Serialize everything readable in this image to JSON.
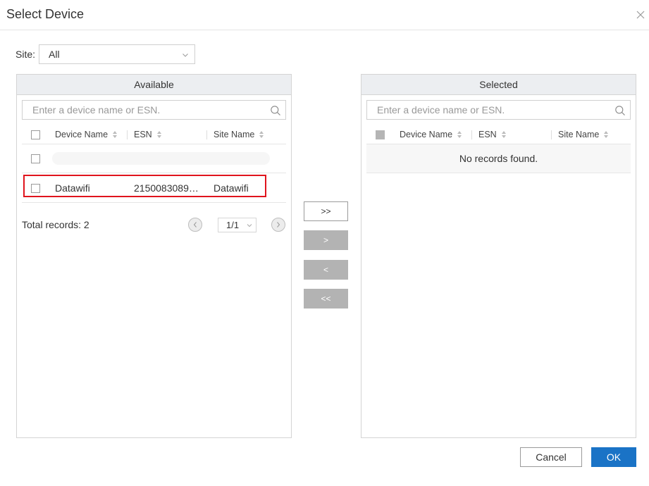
{
  "dialog": {
    "title": "Select Device"
  },
  "site": {
    "label": "Site:",
    "value": "All"
  },
  "available": {
    "title": "Available",
    "search_placeholder": "Enter a device name or ESN.",
    "columns": [
      "Device Name",
      "ESN",
      "Site Name"
    ],
    "rows": [
      {
        "device_name": "Datawifi",
        "esn": "2150083089…",
        "site_name": "Datawifi"
      }
    ],
    "total_label": "Total records: 2",
    "page": "1/1"
  },
  "selected": {
    "title": "Selected",
    "search_placeholder": "Enter a device name or ESN.",
    "columns": [
      "Device Name",
      "ESN",
      "Site Name"
    ],
    "empty_text": "No records found."
  },
  "transfer": {
    "add_all": ">>",
    "add": ">",
    "remove": "<",
    "remove_all": "<<"
  },
  "buttons": {
    "cancel": "Cancel",
    "ok": "OK"
  },
  "colors": {
    "primary": "#1a73c6",
    "highlight": "#e0141d",
    "header_bg": "#eceef1",
    "disabled": "#b3b3b3"
  }
}
